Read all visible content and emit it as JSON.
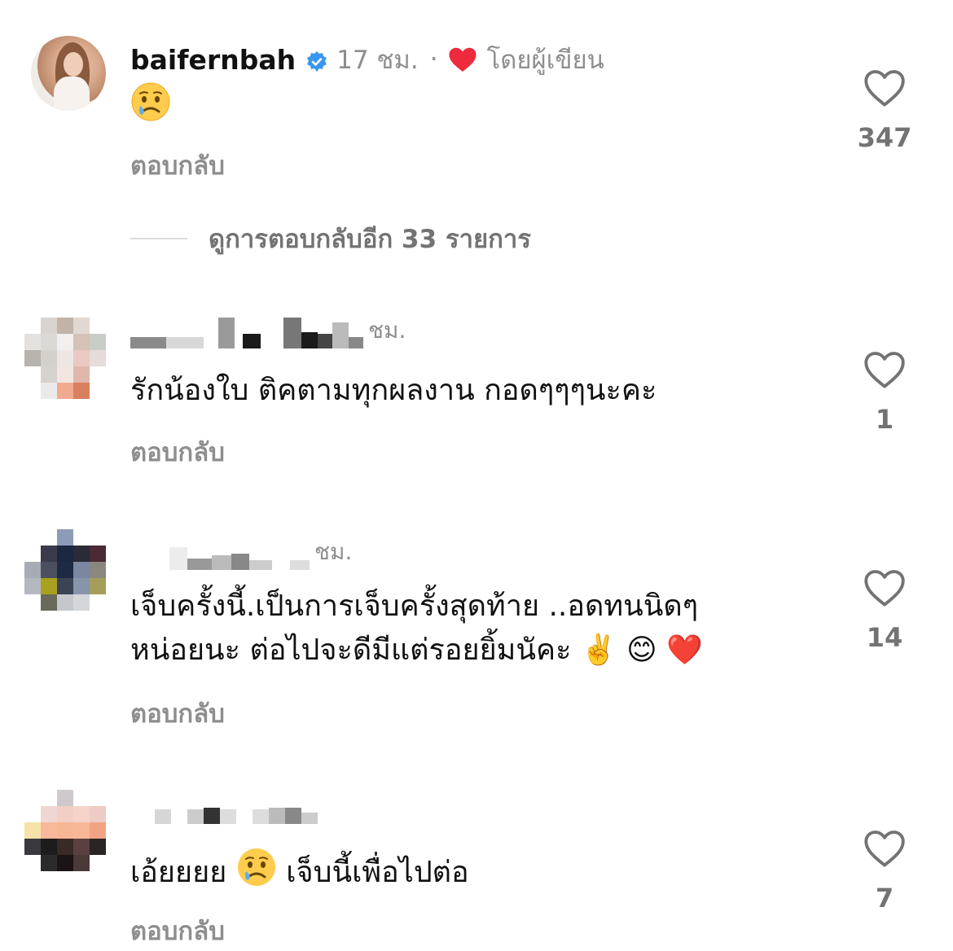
{
  "comments": [
    {
      "username": "baifernbah",
      "time": "17 ชม.",
      "separator": "·",
      "author_liked_label": "โดยผู้เขียน",
      "text": "😢",
      "reply_label": "ตอบกลับ",
      "likes": "347",
      "verified": true
    },
    {
      "username_redacted": true,
      "time": "ชม.",
      "text": "รักน้องใบ ติคตามทุกผลงาน  กอดๆๆๆนะคะ",
      "reply_label": "ตอบกลับ",
      "likes": "1"
    },
    {
      "username_redacted": true,
      "time": "ชม.",
      "text_line1": "เจ็บครั้งนี้.เป็นการเจ็บครั้งสุดท้าย ..อดทนนิดๆ",
      "text_line2": "หน่อยนะ ต่อไปจะดีมีแต่รอยยิ้มนัคะ ✌️ 😊 ❤️",
      "reply_label": "ตอบกลับ",
      "likes": "14"
    },
    {
      "username_redacted": true,
      "time": "",
      "text": "เอ้ยยยย 😢  เจ็บนี้เพื่อไปต่อ",
      "reply_label": "ตอบกลับ",
      "likes": "7"
    }
  ],
  "view_more_replies": "ดูการตอบกลับอีก 33 รายการ",
  "colors": {
    "verified": "#3897f0",
    "heart": "#ed2b3c",
    "secondary_text": "#8e8e8e"
  }
}
